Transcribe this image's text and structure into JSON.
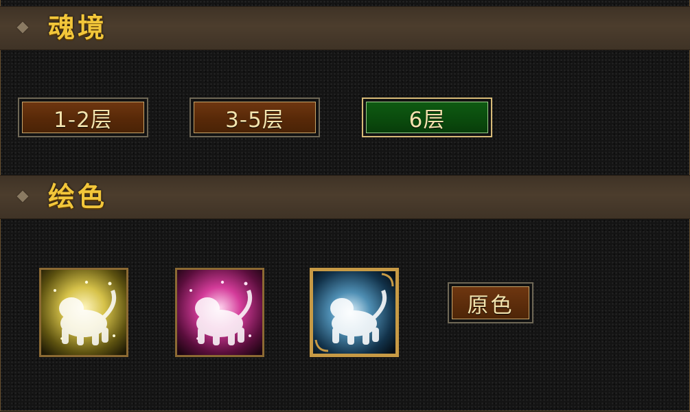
{
  "sections": {
    "soul_realm": {
      "title": "魂境"
    },
    "paint_color": {
      "title": "绘色"
    }
  },
  "layer_buttons": [
    {
      "label": "1-2层",
      "active": false
    },
    {
      "label": "3-5层",
      "active": false
    },
    {
      "label": "6层",
      "active": true
    }
  ],
  "color_options": [
    {
      "name": "gold-tiger-icon",
      "tint": "#d6c24a"
    },
    {
      "name": "pink-tiger-icon",
      "tint": "#d43c9a"
    },
    {
      "name": "ice-tiger-icon",
      "tint": "#4f8fb4",
      "selected": true
    }
  ],
  "original_color_button": {
    "label": "原色"
  },
  "colors": {
    "title_gold": "#f2c63a",
    "button_brown": "#582908",
    "button_green": "#0a4a0d",
    "frame_gold": "#8c6a33"
  }
}
